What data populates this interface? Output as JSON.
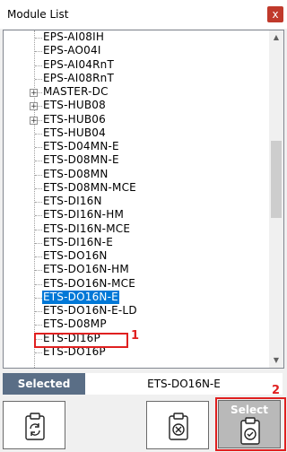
{
  "window": {
    "title": "Module List",
    "close_label": "x"
  },
  "tree": {
    "items": [
      {
        "label": "EPS-AI08IH",
        "expandable": false
      },
      {
        "label": "EPS-AO04I",
        "expandable": false
      },
      {
        "label": "EPS-AI04RnT",
        "expandable": false
      },
      {
        "label": "EPS-AI08RnT",
        "expandable": false
      },
      {
        "label": "MASTER-DC",
        "expandable": true
      },
      {
        "label": "ETS-HUB08",
        "expandable": true
      },
      {
        "label": "ETS-HUB06",
        "expandable": true
      },
      {
        "label": "ETS-HUB04",
        "expandable": false
      },
      {
        "label": "ETS-D04MN-E",
        "expandable": false
      },
      {
        "label": "ETS-D08MN-E",
        "expandable": false
      },
      {
        "label": "ETS-D08MN",
        "expandable": false
      },
      {
        "label": "ETS-D08MN-MCE",
        "expandable": false
      },
      {
        "label": "ETS-DI16N",
        "expandable": false
      },
      {
        "label": "ETS-DI16N-HM",
        "expandable": false
      },
      {
        "label": "ETS-DI16N-MCE",
        "expandable": false
      },
      {
        "label": "ETS-DI16N-E",
        "expandable": false
      },
      {
        "label": "ETS-DO16N",
        "expandable": false
      },
      {
        "label": "ETS-DO16N-HM",
        "expandable": false
      },
      {
        "label": "ETS-DO16N-MCE",
        "expandable": false
      },
      {
        "label": "ETS-DO16N-E",
        "expandable": false,
        "selected": true
      },
      {
        "label": "ETS-DO16N-E-LD",
        "expandable": false
      },
      {
        "label": "ETS-D08MP",
        "expandable": false
      },
      {
        "label": "ETS-DI16P",
        "expandable": false
      },
      {
        "label": "ETS-DO16P",
        "expandable": false
      }
    ]
  },
  "annotations": {
    "marker_1": "1",
    "marker_2": "2"
  },
  "selection": {
    "label": "Selected",
    "value": "ETS-DO16N-E"
  },
  "buttons": {
    "select_label": "Select"
  },
  "colors": {
    "selection_highlight": "#0078d7",
    "annotation_red": "#e02020",
    "selected_label_bg": "#5a6e86"
  }
}
